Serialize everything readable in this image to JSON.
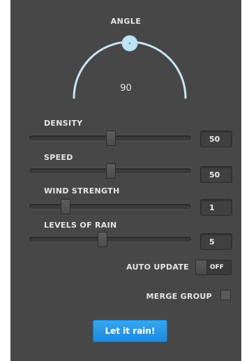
{
  "angle": {
    "label": "ANGLE",
    "value": "90"
  },
  "sliders": [
    {
      "label": "DENSITY",
      "value": "50",
      "fraction": 0.5
    },
    {
      "label": "SPEED",
      "value": "50",
      "fraction": 0.5
    },
    {
      "label": "WIND STRENGTH",
      "value": "1",
      "fraction": 0.22
    },
    {
      "label": "LEVELS OF RAIN",
      "value": "5",
      "fraction": 0.45
    }
  ],
  "auto_update": {
    "label": "AUTO UPDATE",
    "state": "OFF"
  },
  "merge_group": {
    "label": "MERGE GROUP",
    "checked": false
  },
  "action_button": {
    "label": "Let it rain!"
  },
  "colors": {
    "panel": "#474747",
    "accent": "#c8e6f5",
    "button": "#2b9be6",
    "text": "#e6e6e6"
  }
}
